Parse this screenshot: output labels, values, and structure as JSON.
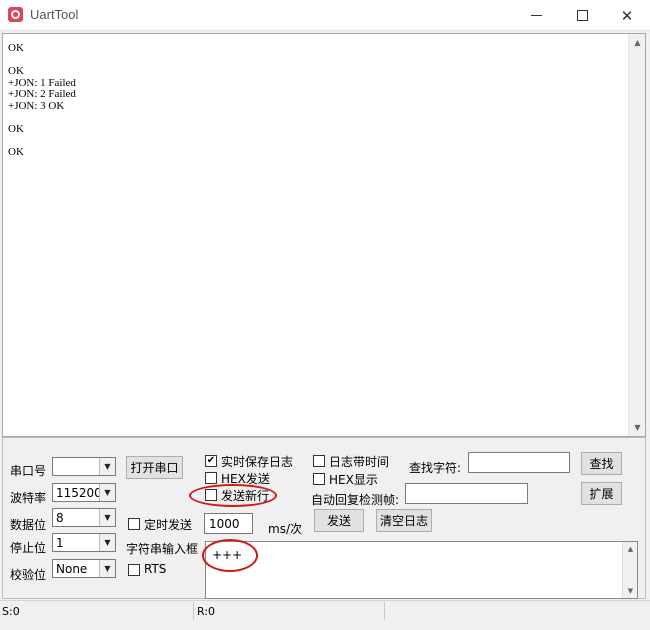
{
  "window": {
    "title": "UartTool",
    "icon": "app-logo-icon",
    "controls": [
      "minimize-icon",
      "maximize-icon",
      "close-icon"
    ]
  },
  "output": {
    "text": "OK\n\nOK\n+JON: 1 Failed\n+JON: 2 Failed\n+JON: 3 OK\n\nOK\n\nOK"
  },
  "settings": {
    "port_label": "串口号",
    "port_value": "",
    "baud_label": "波特率",
    "baud_value": "115200",
    "databits_label": "数据位",
    "databits_value": "8",
    "stopbits_label": "停止位",
    "stopbits_value": "1",
    "parity_label": "校验位",
    "parity_value": "None"
  },
  "actions": {
    "open_port": "打开串口",
    "send": "发送",
    "clear_log": "清空日志",
    "find": "查找",
    "expand": "扩展"
  },
  "options": {
    "realtime_log": {
      "label": "实时保存日志",
      "checked": true
    },
    "hex_send": {
      "label": "HEX发送",
      "checked": false
    },
    "send_newline": {
      "label": "发送新行",
      "checked": false
    },
    "log_timestamp": {
      "label": "日志带时间",
      "checked": false
    },
    "hex_display": {
      "label": "HEX显示",
      "checked": false
    },
    "timed_send": {
      "label": "定时发送",
      "checked": false
    },
    "rts": {
      "label": "RTS",
      "checked": false
    }
  },
  "search": {
    "label": "查找字符:",
    "value": ""
  },
  "auto_reply": {
    "label": "自动回复检测帧:",
    "value": ""
  },
  "timer": {
    "interval": "1000",
    "unit": "ms/次"
  },
  "input": {
    "label": "字符串输入框",
    "value": "+++"
  },
  "status": {
    "sent": "S:0",
    "received": "R:0"
  },
  "colors": {
    "annotation_ring": "#d01818",
    "app_icon": "#e0445c"
  }
}
